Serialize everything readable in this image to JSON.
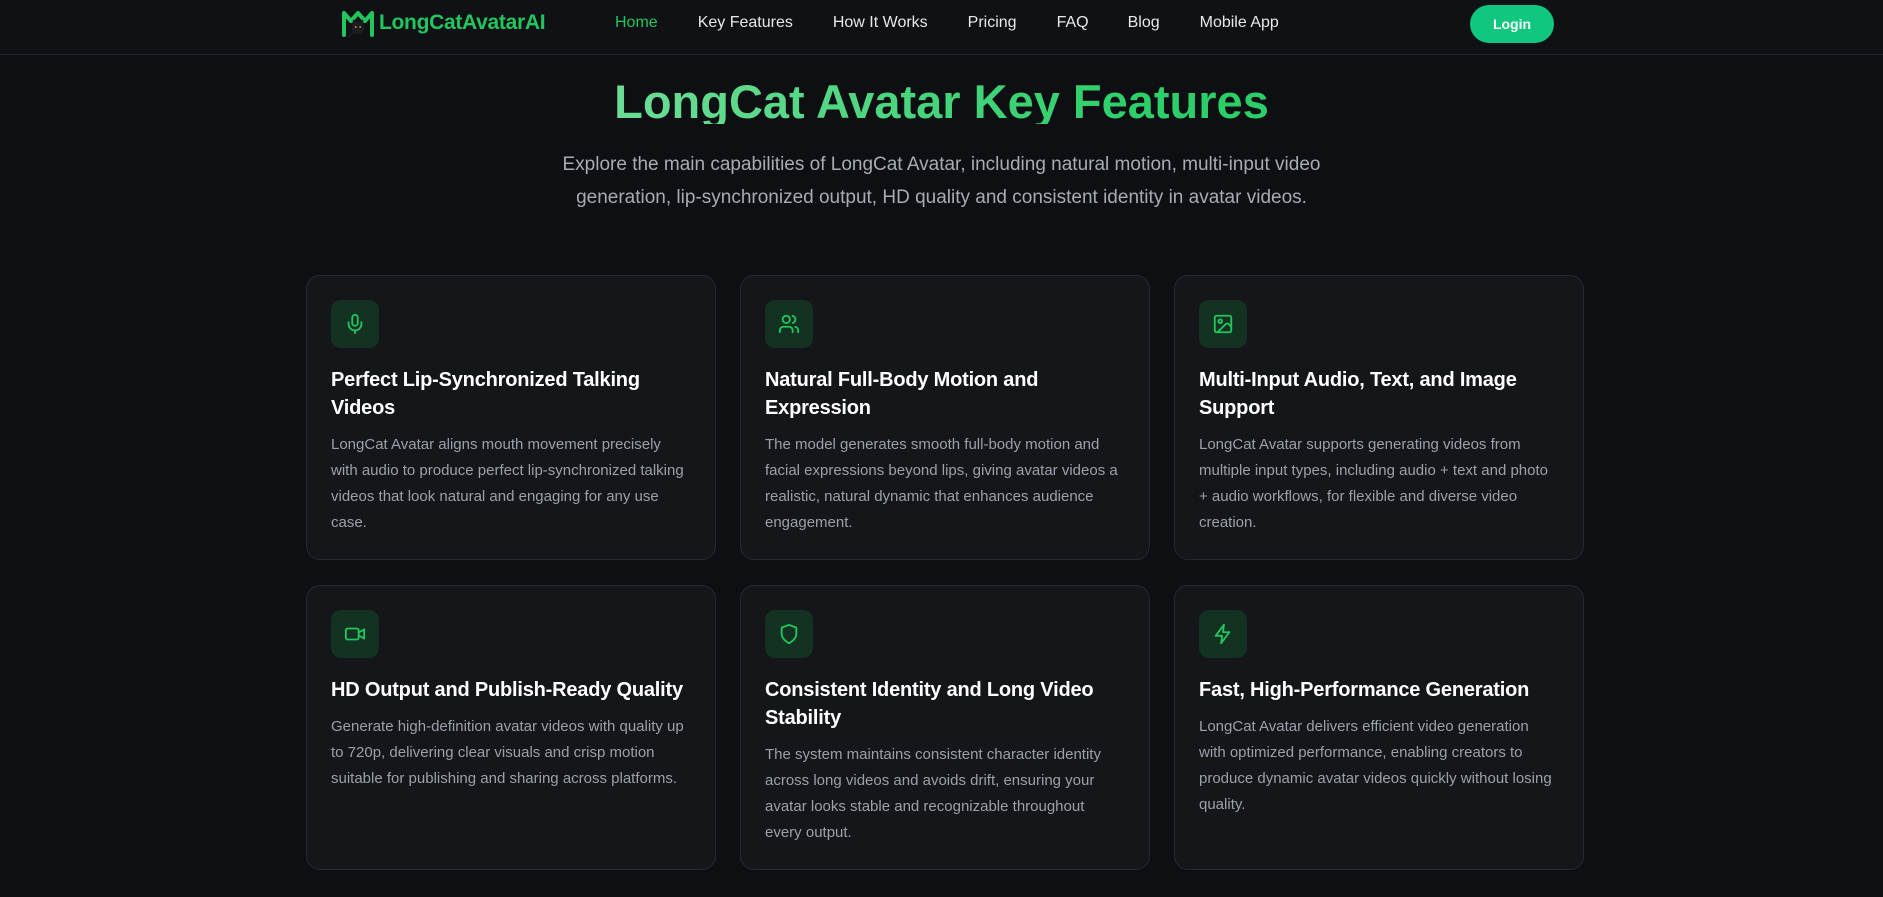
{
  "brand": {
    "name": "LongCatAvatarAI"
  },
  "nav": {
    "items": [
      {
        "label": "Home",
        "active": true
      },
      {
        "label": "Key Features"
      },
      {
        "label": "How It Works"
      },
      {
        "label": "Pricing"
      },
      {
        "label": "FAQ"
      },
      {
        "label": "Blog"
      },
      {
        "label": "Mobile App"
      }
    ],
    "login_label": "Login"
  },
  "hero": {
    "title": "LongCat Avatar Key Features",
    "subtitle": "Explore the main capabilities of LongCat Avatar, including natural motion, multi-input video generation, lip-synchronized output, HD quality and consistent identity in avatar videos."
  },
  "features": [
    {
      "icon": "microphone-icon",
      "title": "Perfect Lip-Synchronized Talking Videos",
      "description": "LongCat Avatar aligns mouth movement precisely with audio to produce perfect lip-synchronized talking videos that look natural and engaging for any use case."
    },
    {
      "icon": "users-icon",
      "title": "Natural Full-Body Motion and Expression",
      "description": "The model generates smooth full-body motion and facial expressions beyond lips, giving avatar videos a realistic, natural dynamic that enhances audience engagement."
    },
    {
      "icon": "image-icon",
      "title": "Multi-Input Audio, Text, and Image Support",
      "description": "LongCat Avatar supports generating videos from multiple input types, including audio + text and photo + audio workflows, for flexible and diverse video creation."
    },
    {
      "icon": "video-camera-icon",
      "title": "HD Output and Publish-Ready Quality",
      "description": "Generate high-definition avatar videos with quality up to 720p, delivering clear visuals and crisp motion suitable for publishing and sharing across platforms."
    },
    {
      "icon": "shield-icon",
      "title": "Consistent Identity and Long Video Stability",
      "description": "The system maintains consistent character identity across long videos and avoids drift, ensuring your avatar looks stable and recognizable throughout every output."
    },
    {
      "icon": "lightning-icon",
      "title": "Fast, High-Performance Generation",
      "description": "LongCat Avatar delivers efficient video generation with optimized performance, enabling creators to produce dynamic avatar videos quickly without losing quality."
    }
  ],
  "colors": {
    "background": "#0d0f12",
    "accent": "#22c55e",
    "button": "#10c77f",
    "card": "#141619"
  }
}
